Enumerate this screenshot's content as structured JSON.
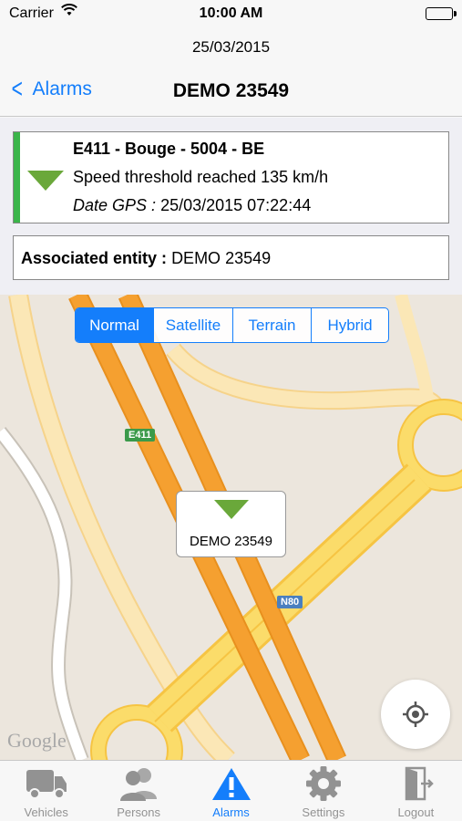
{
  "status_bar": {
    "carrier": "Carrier",
    "time": "10:00 AM"
  },
  "date": "25/03/2015",
  "nav": {
    "back_label": "Alarms",
    "title": "DEMO 23549"
  },
  "alarm": {
    "location": "E411 - Bouge - 5004 - BE",
    "message": "Speed threshold reached 135 km/h",
    "date_label": "Date GPS :",
    "date_value": "25/03/2015 07:22:44",
    "status_color": "#3bb54a",
    "icon": "green-down-triangle-icon"
  },
  "entity": {
    "label": "Associated entity :",
    "value": "DEMO 23549"
  },
  "map": {
    "types": [
      "Normal",
      "Satellite",
      "Terrain",
      "Hybrid"
    ],
    "selected_type": "Normal",
    "road_labels": [
      "E411",
      "N80"
    ],
    "marker_label": "DEMO 23549",
    "attribution": "Google"
  },
  "tabs": [
    {
      "label": "Vehicles",
      "icon": "truck-icon"
    },
    {
      "label": "Persons",
      "icon": "persons-icon"
    },
    {
      "label": "Alarms",
      "icon": "alert-triangle-icon"
    },
    {
      "label": "Settings",
      "icon": "gear-icon"
    },
    {
      "label": "Logout",
      "icon": "logout-door-icon"
    }
  ],
  "active_tab": "Alarms",
  "colors": {
    "accent": "#147efb",
    "alarm_green": "#6aa83a",
    "highway_orange": "#f5a030"
  }
}
